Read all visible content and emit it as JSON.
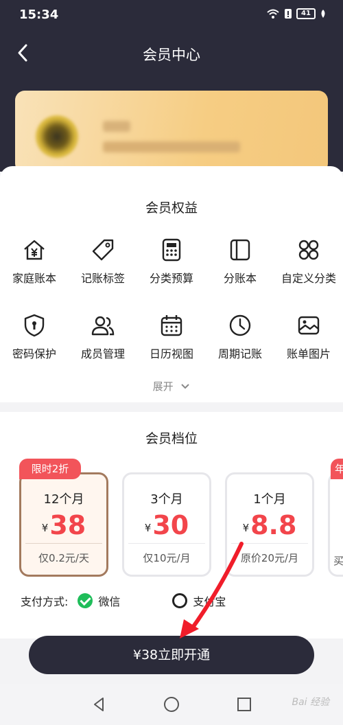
{
  "status_bar": {
    "time": "15:34",
    "battery": "41"
  },
  "nav": {
    "title": "会员中心"
  },
  "benefits": {
    "title": "会员权益",
    "items": [
      {
        "label": "家庭账本",
        "icon": "home-yen-icon"
      },
      {
        "label": "记账标签",
        "icon": "tag-icon"
      },
      {
        "label": "分类预算",
        "icon": "calculator-icon"
      },
      {
        "label": "分账本",
        "icon": "book-icon"
      },
      {
        "label": "自定义分类",
        "icon": "grid-four-icon"
      },
      {
        "label": "密码保护",
        "icon": "shield-lock-icon"
      },
      {
        "label": "成员管理",
        "icon": "users-icon"
      },
      {
        "label": "日历视图",
        "icon": "calendar-icon"
      },
      {
        "label": "周期记账",
        "icon": "clock-icon"
      },
      {
        "label": "账单图片",
        "icon": "image-icon"
      }
    ],
    "expand_label": "展开"
  },
  "plans": {
    "title": "会员档位",
    "badge": "限时2折",
    "partial_badge": "年",
    "partial_sub": "买",
    "currency": "¥",
    "options": [
      {
        "duration": "12个月",
        "price": "38",
        "note": "仅0.2元/天",
        "selected": true
      },
      {
        "duration": "3个月",
        "price": "30",
        "note": "仅10元/月",
        "selected": false
      },
      {
        "duration": "1个月",
        "price": "8.8",
        "note": "原价20元/月",
        "selected": false
      }
    ]
  },
  "payment": {
    "label": "支付方式:",
    "options": [
      {
        "name": "微信",
        "checked": true
      },
      {
        "name": "支付宝",
        "checked": false
      }
    ]
  },
  "cta": {
    "label": "¥38立即开通"
  },
  "watermark": "Bai 经验",
  "colors": {
    "header": "#2b2b3a",
    "price_red": "#f2454b",
    "badge_red": "#f2545a",
    "wechat_green": "#1fbd5a",
    "selected_border": "#a37a5e"
  }
}
